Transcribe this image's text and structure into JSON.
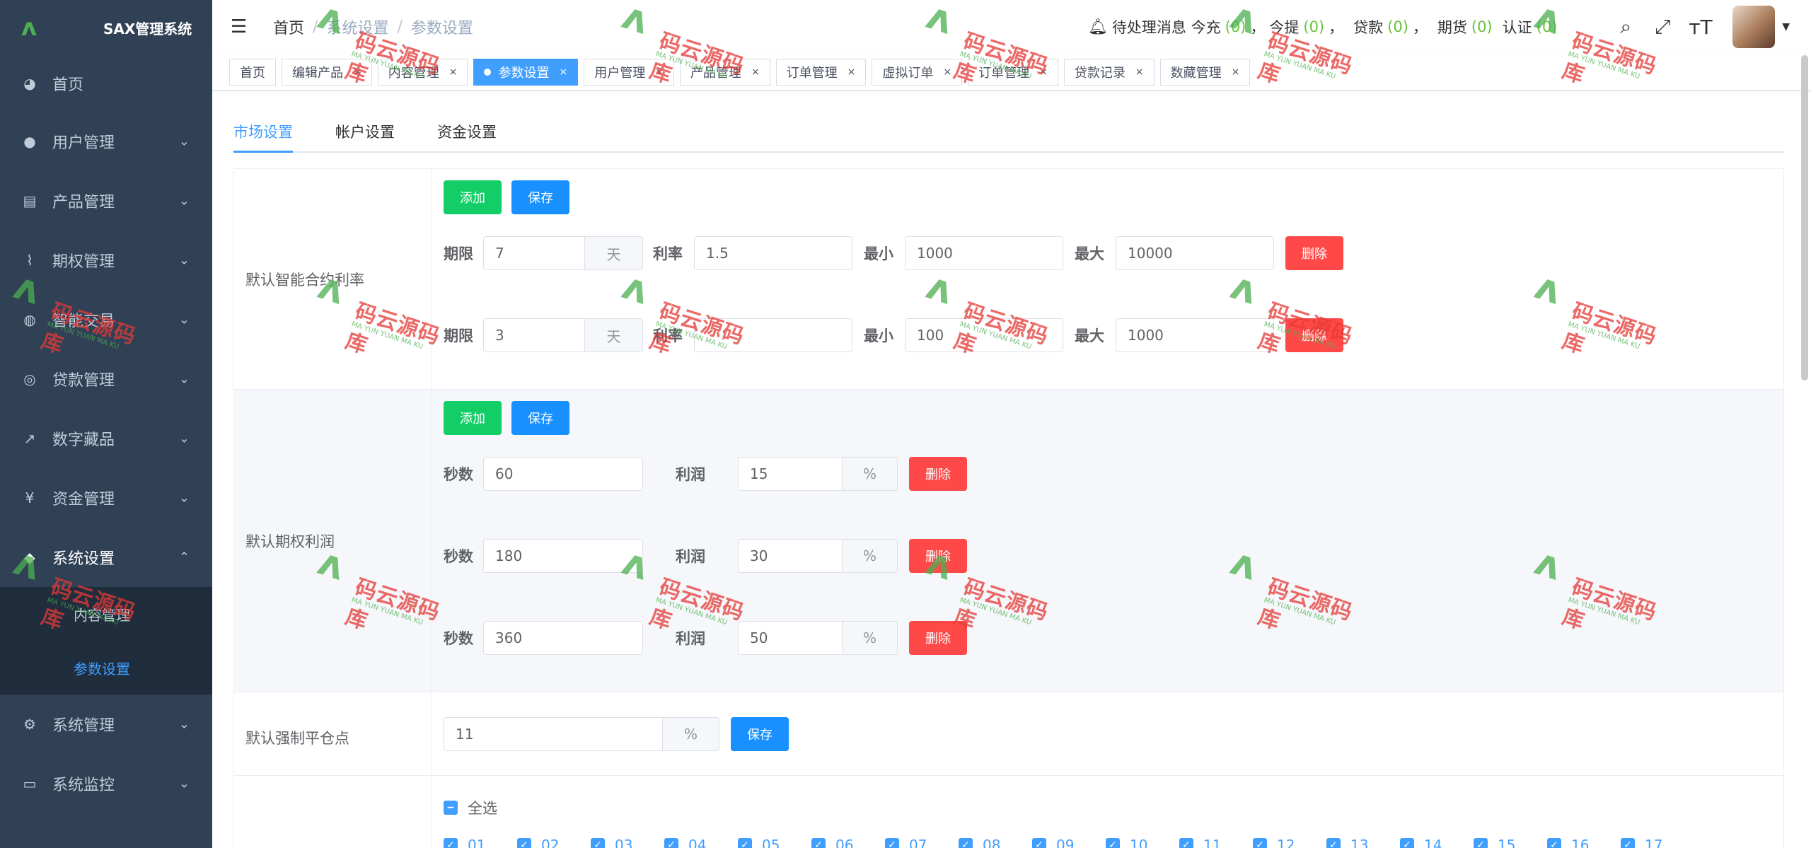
{
  "app": {
    "title": "SAX管理系统"
  },
  "sidebar": {
    "items": [
      {
        "label": "首页",
        "icon": "dashboard-icon"
      },
      {
        "label": "用户管理",
        "icon": "user-icon"
      },
      {
        "label": "产品管理",
        "icon": "document-icon"
      },
      {
        "label": "期权管理",
        "icon": "chart-icon"
      },
      {
        "label": "智能交易",
        "icon": "bolt-icon"
      },
      {
        "label": "贷款管理",
        "icon": "coins-icon"
      },
      {
        "label": "数字藏品",
        "icon": "trend-icon"
      },
      {
        "label": "资金管理",
        "icon": "money-icon"
      },
      {
        "label": "系统设置",
        "icon": "settings-icon"
      },
      {
        "label": "系统管理",
        "icon": "gear-icon"
      },
      {
        "label": "系统监控",
        "icon": "monitor-icon"
      }
    ],
    "submenu": [
      {
        "label": "内容管理"
      },
      {
        "label": "参数设置"
      }
    ]
  },
  "header": {
    "breadcrumb": [
      "首页",
      "系统设置",
      "参数设置"
    ],
    "notices": {
      "label": "待处理消息 今充",
      "today_count": "(0)",
      "withdraw_label": "今提",
      "withdraw_count": "(0)",
      "loan_label": "贷款",
      "loan_count": "(0)",
      "futures_label": "期货",
      "futures_count": "(0)",
      "realname_label": "认证",
      "realname_count": "(0)",
      "comma": "，"
    }
  },
  "tags": [
    {
      "label": "首页"
    },
    {
      "label": "编辑产品"
    },
    {
      "label": "内容管理"
    },
    {
      "label": "参数设置"
    },
    {
      "label": "用户管理"
    },
    {
      "label": "产品管理"
    },
    {
      "label": "订单管理"
    },
    {
      "label": "虚拟订单"
    },
    {
      "label": "订单管理"
    },
    {
      "label": "贷款记录"
    },
    {
      "label": "数藏管理"
    }
  ],
  "tabs": [
    "市场设置",
    "帐户设置",
    "资金设置"
  ],
  "buttons": {
    "add": "添加",
    "save": "保存",
    "delete": "删除"
  },
  "contract": {
    "label": "默认智能合约利率",
    "fields": {
      "term": "期限",
      "unit_day": "天",
      "rate": "利率",
      "min": "最小",
      "max": "最大"
    },
    "rows": [
      {
        "term": "7",
        "rate": "1.5",
        "min": "1000",
        "max": "10000"
      },
      {
        "term": "3",
        "rate": "",
        "min": "100",
        "max": "1000"
      }
    ]
  },
  "option": {
    "label": "默认期权利润",
    "fields": {
      "seconds": "秒数",
      "profit": "利润",
      "unit_pct": "%"
    },
    "rows": [
      {
        "seconds": "60",
        "profit": "15"
      },
      {
        "seconds": "180",
        "profit": "30"
      },
      {
        "seconds": "360",
        "profit": "50"
      }
    ]
  },
  "liquidation": {
    "label": "默认强制平仓点",
    "value": "11",
    "unit": "%"
  },
  "hours": {
    "select_all": "全选",
    "items": [
      "01",
      "02",
      "03",
      "04",
      "05",
      "06",
      "07",
      "08",
      "09",
      "10",
      "11",
      "12",
      "13",
      "14",
      "15",
      "16",
      "17"
    ]
  },
  "watermark": {
    "text": "码云源码库",
    "sub": "MA YUN YUAN MA KU"
  },
  "colors": {
    "sidebar": "#304156",
    "accent": "#409eff",
    "green": "#13ce66",
    "red": "#ff4949"
  }
}
